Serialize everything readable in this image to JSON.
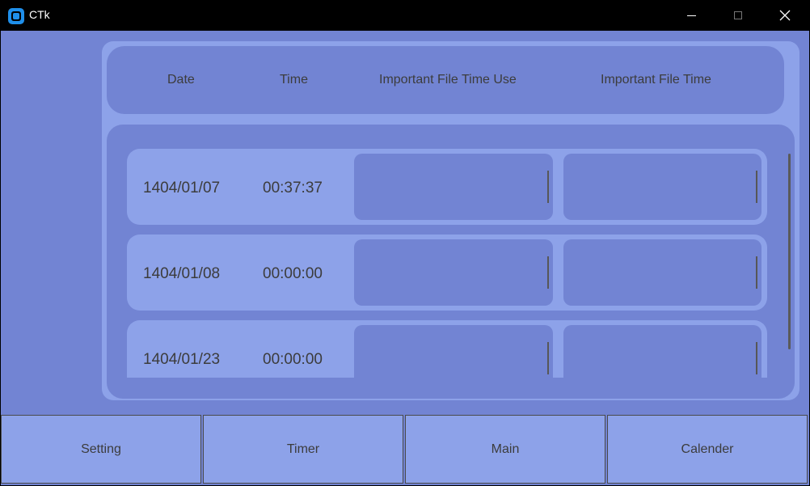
{
  "window": {
    "title": "CTk",
    "icon": "app-icon",
    "controls": [
      "minimize-icon",
      "maximize-icon",
      "close-icon"
    ]
  },
  "colors": {
    "titlebar": "#000000",
    "background": "#7284d3",
    "panel_light": "#8da2e9",
    "text": "#3c3c3c"
  },
  "header": {
    "date": "Date",
    "time": "Time",
    "file_time_use": "Important File Time Use",
    "file_time": "Important File Time"
  },
  "rows": [
    {
      "date": "1404/01/07",
      "time": "00:37:37",
      "file_time_use": "",
      "file_time": ""
    },
    {
      "date": "1404/01/08",
      "time": "00:00:00",
      "file_time_use": "",
      "file_time": ""
    },
    {
      "date": "1404/01/23",
      "time": "00:00:00",
      "file_time_use": "",
      "file_time": ""
    }
  ],
  "nav": {
    "setting": "Setting",
    "timer": "Timer",
    "main": "Main",
    "calender": "Calender"
  }
}
